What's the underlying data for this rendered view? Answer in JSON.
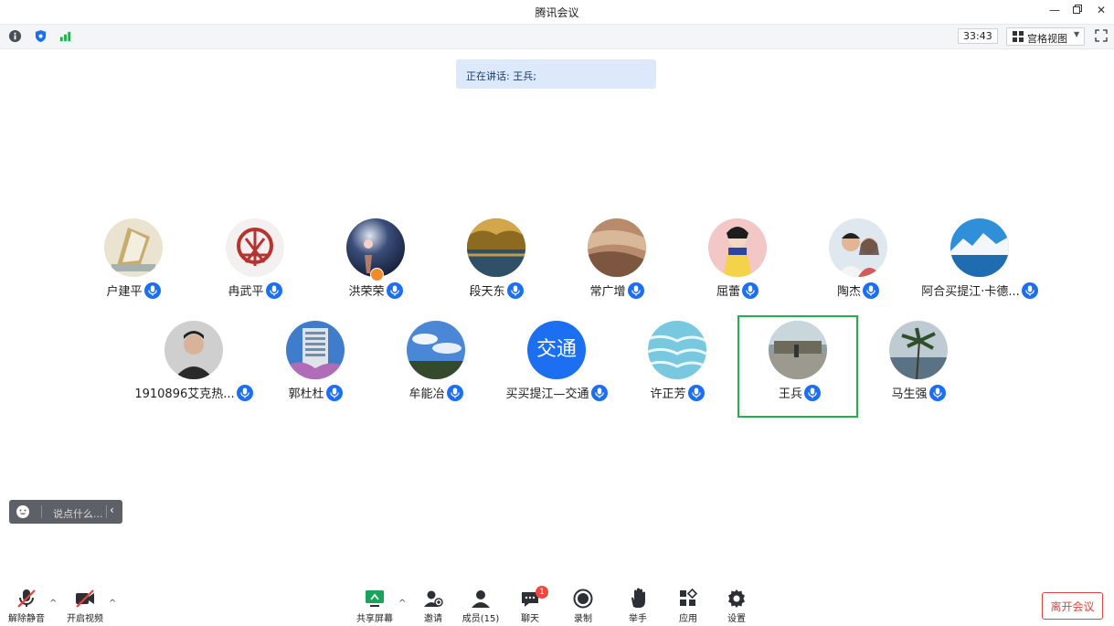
{
  "window": {
    "title": "腾讯会议"
  },
  "toolbar": {
    "timer": "33:43",
    "view_label": "宫格视图"
  },
  "speaking": {
    "text": "正在讲话: 王兵;"
  },
  "participants": [
    {
      "name": "户建平"
    },
    {
      "name": "冉武平"
    },
    {
      "name": "洪荣荣"
    },
    {
      "name": "段天东"
    },
    {
      "name": "常广增"
    },
    {
      "name": "屈蕾"
    },
    {
      "name": "陶杰"
    },
    {
      "name": "阿合买提江·卡德..."
    },
    {
      "name": "1910896艾克热..."
    },
    {
      "name": "郭杜杜"
    },
    {
      "name": "牟能冶"
    },
    {
      "name": "买买提江—交通",
      "avatar_text": "交通"
    },
    {
      "name": "许正芳"
    },
    {
      "name": "王兵",
      "active": true
    },
    {
      "name": "马生强"
    }
  ],
  "chat": {
    "placeholder": "说点什么..."
  },
  "controls": {
    "unmute": "解除静音",
    "start_video": "开启视频",
    "share_screen": "共享屏幕",
    "invite": "邀请",
    "members": "成员(15)",
    "chat": "聊天",
    "chat_badge": "1",
    "record": "录制",
    "raise_hand": "举手",
    "apps": "应用",
    "settings": "设置",
    "leave": "离开会议"
  },
  "colors": {
    "accent": "#1d6ff2",
    "active_border": "#22b04d",
    "leave": "#e3453c"
  }
}
